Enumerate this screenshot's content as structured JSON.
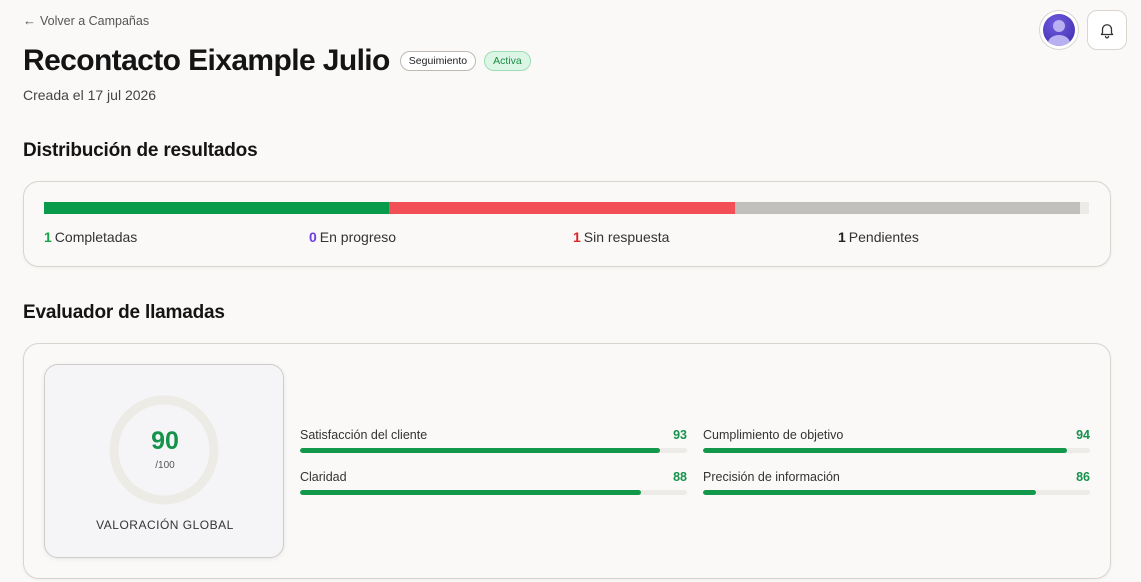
{
  "nav": {
    "back_arrow": "←",
    "back_label": "Volver a Campañas"
  },
  "header": {
    "title": "Recontacto Eixample Julio",
    "type_badge": "Seguimiento",
    "status_badge": "Activa",
    "created": "Creada el 17 jul 2026"
  },
  "icons": {
    "avatar": "user-avatar-icon",
    "notifications": "bell-icon"
  },
  "distribution": {
    "title": "Distribución de resultados",
    "segments": [
      {
        "key": "completed",
        "count": 1,
        "color": "#079b4b"
      },
      {
        "key": "in_progress",
        "count": 0,
        "color": "#6c3fd8"
      },
      {
        "key": "no_answer",
        "count": 1,
        "color": "#f24f57"
      },
      {
        "key": "pending",
        "count": 1,
        "color": "#c2c0bd"
      }
    ],
    "legend": [
      {
        "count": "1",
        "label": "Completadas",
        "color": "#16a34a"
      },
      {
        "count": "0",
        "label": "En progreso",
        "color": "#6d3fe0"
      },
      {
        "count": "1",
        "label": "Sin respuesta",
        "color": "#dc2626"
      },
      {
        "count": "1",
        "label": "Pendientes",
        "color": "#222222"
      }
    ]
  },
  "evaluator": {
    "title": "Evaluador de llamadas",
    "score": "90",
    "score_max": "/100",
    "score_label": "VALORACIÓN GLOBAL",
    "metrics": [
      {
        "label": "Satisfacción del cliente",
        "value": "93",
        "fraction": 0.93
      },
      {
        "label": "Cumplimiento de objetivo",
        "value": "94",
        "fraction": 0.94
      },
      {
        "label": "Claridad",
        "value": "88",
        "fraction": 0.88
      },
      {
        "label": "Precisión de información",
        "value": "86",
        "fraction": 0.86
      }
    ]
  },
  "colors": {
    "accent_green": "#15924b",
    "background": "#faf9f7"
  }
}
